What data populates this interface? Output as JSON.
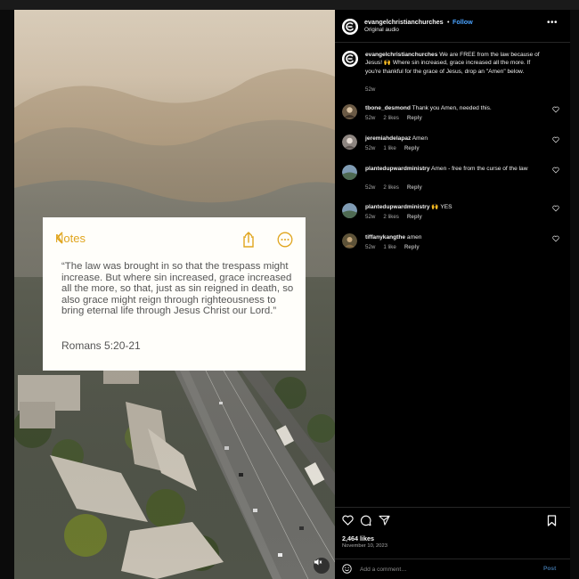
{
  "media": {
    "note": {
      "back_label": "Notes",
      "quote": "“The law was brought in so that the trespass might increase. But where sin increased, grace increased all the more, so that, just as sin reigned in death, so also grace might reign through righteousness to bring eternal life through Jesus Christ our Lord.”",
      "reference": "Romans 5:20-21",
      "accent_color": "#e0a51e"
    },
    "mute_icon": "speaker-muted-icon"
  },
  "post": {
    "author": "evangelchristianchurches",
    "separator": "•",
    "follow_label": "Follow",
    "audio_label": "Original audio",
    "more_label": "•••",
    "caption": {
      "user": "evangelchristianchurches",
      "text": "We are FREE from the law because of Jesus! 🙌 Where sin increased, grace increased all the more. If you're thankful for the grace of Jesus, drop an \"Amen\" below.",
      "time": "52w"
    },
    "comments": [
      {
        "user": "tbone_desmond",
        "text": "Thank you Amen, needed this.",
        "time": "52w",
        "likes": "2 likes",
        "reply": "Reply"
      },
      {
        "user": "jeremiahdelapaz",
        "text": "Amen",
        "time": "52w",
        "likes": "1 like",
        "reply": "Reply"
      },
      {
        "user": "plantedupwardministry",
        "text": "Amen - free from the curse of the law",
        "time": "52w",
        "likes": "2 likes",
        "reply": "Reply"
      },
      {
        "user": "plantedupwardministry",
        "text": "🙌 YES",
        "time": "52w",
        "likes": "2 likes",
        "reply": "Reply"
      },
      {
        "user": "tiffanykangthe",
        "text": "amen",
        "time": "52w",
        "likes": "1 like",
        "reply": "Reply"
      }
    ],
    "likes": "2,464 likes",
    "date": "November 10, 2023",
    "comment_placeholder": "Add a comment…",
    "post_label": "Post",
    "colors": {
      "follow": "#4aa3ff",
      "post_button": "#3c6d9d"
    }
  }
}
